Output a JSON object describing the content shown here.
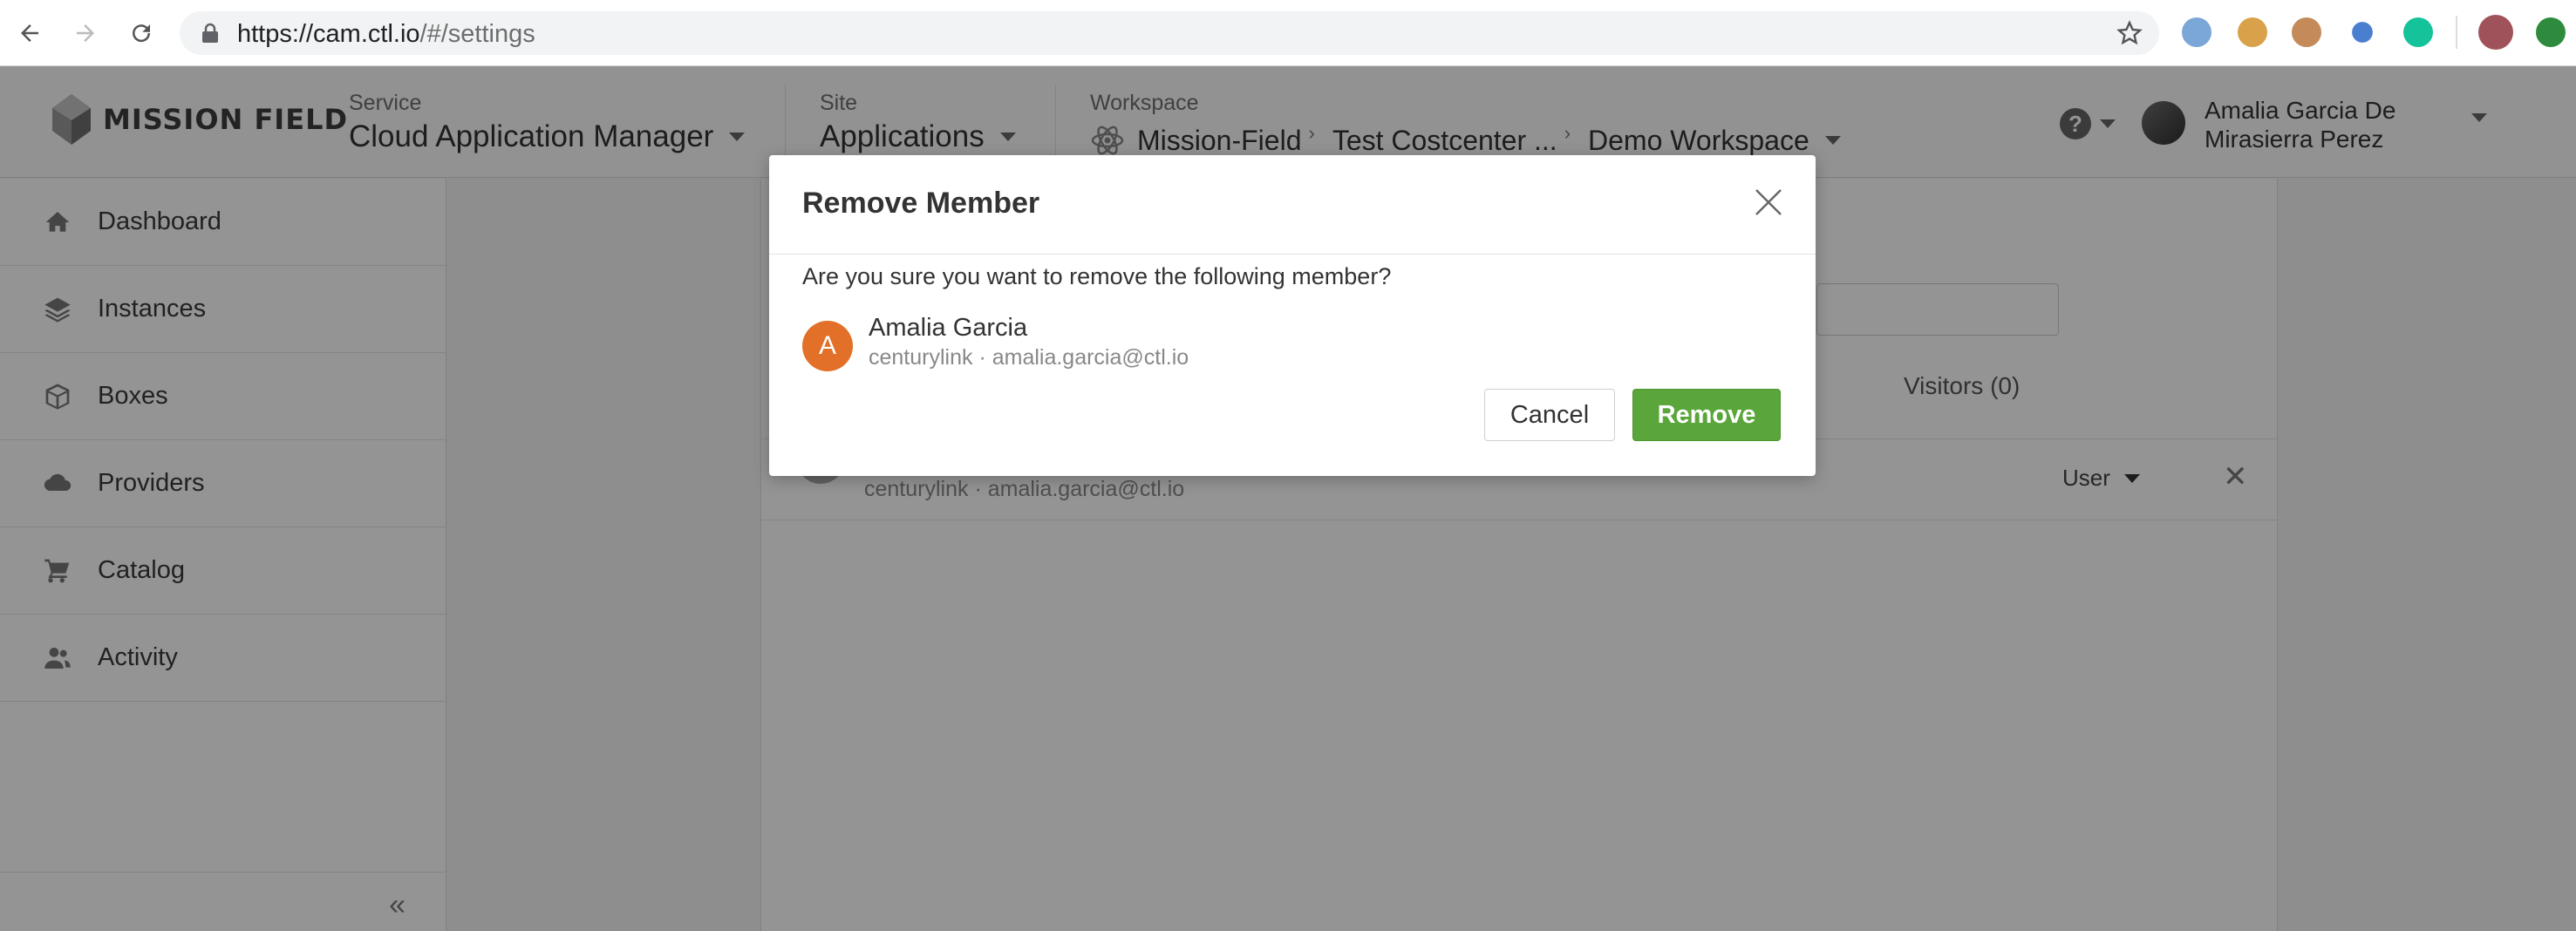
{
  "browser": {
    "url_host": "https://cam.ctl.io",
    "url_path": "/#/settings"
  },
  "header": {
    "logo_text": "MISSION FIELD",
    "service_label": "Service",
    "service_value": "Cloud Application Manager",
    "site_label": "Site",
    "site_value": "Applications",
    "workspace_label": "Workspace",
    "workspace_path": [
      "Mission-Field",
      "Test Costcenter ...",
      "Demo Workspace"
    ],
    "chevron": "›",
    "help_glyph": "?",
    "user_name": "Amalia Garcia De Mirasierra Perez"
  },
  "sidebar": {
    "items": [
      {
        "label": "Dashboard",
        "icon": "home-icon"
      },
      {
        "label": "Instances",
        "icon": "layers-icon"
      },
      {
        "label": "Boxes",
        "icon": "box-icon"
      },
      {
        "label": "Providers",
        "icon": "cloud-icon"
      },
      {
        "label": "Catalog",
        "icon": "cart-icon"
      },
      {
        "label": "Activity",
        "icon": "users-icon"
      }
    ],
    "collapse_glyph": "«"
  },
  "content": {
    "visitors_tab": "Visitors (0)",
    "member_row": {
      "subtitle": "centurylink · amalia.garcia@ctl.io",
      "role": "User",
      "remove_glyph": "✕"
    }
  },
  "modal": {
    "title": "Remove Member",
    "question": "Are you sure you want to remove the following member?",
    "member_initial": "A",
    "member_name": "Amalia Garcia",
    "member_subtitle": "centurylink · amalia.garcia@ctl.io",
    "cancel_label": "Cancel",
    "remove_label": "Remove"
  },
  "colors": {
    "remove_button": "#5aa63a",
    "member_avatar": "#e27028"
  }
}
